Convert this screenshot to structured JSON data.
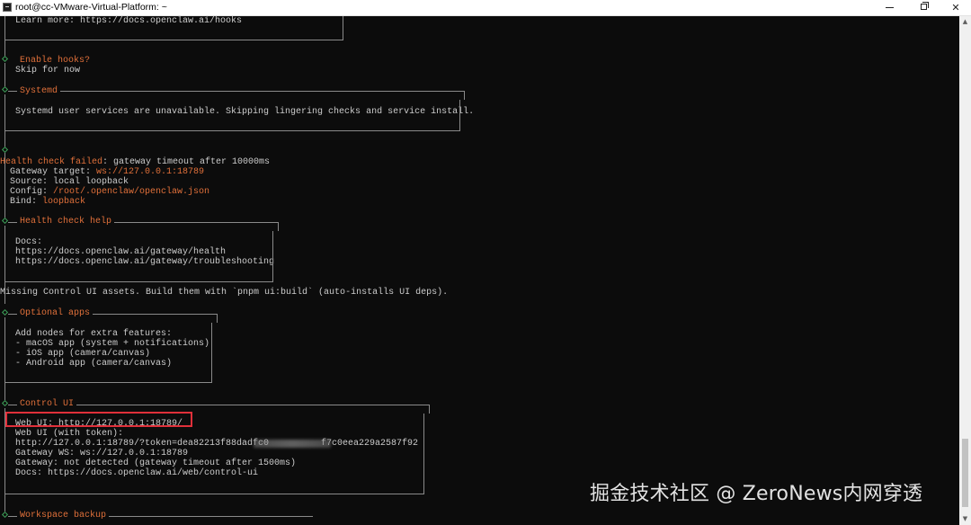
{
  "window": {
    "title": "root@cc-VMware-Virtual-Platform: ~",
    "minimize_label": "minimize",
    "maximize_label": "maximize",
    "close_label": "close"
  },
  "terminal": {
    "hooks_learn_more": "Learn more: https://docs.openclaw.ai/hooks",
    "enable_hooks_q": "Enable hooks?",
    "enable_hooks_a": "Skip for now",
    "systemd_title": "Systemd",
    "systemd_msg": "Systemd user services are unavailable. Skipping lingering checks and service install.",
    "health_failed_label": "Health check failed",
    "health_failed_rest": ": gateway timeout after 10000ms",
    "gateway_target_label": "Gateway target: ",
    "gateway_target_value": "ws://127.0.0.1:18789",
    "source_line": "Source: local loopback",
    "config_label": "Config: ",
    "config_value": "/root/.openclaw/openclaw.json",
    "bind_label": "Bind: ",
    "bind_value": "loopback",
    "health_help_title": "Health check help",
    "docs_label": "Docs:",
    "docs_health": "https://docs.openclaw.ai/gateway/health",
    "docs_troubleshooting": "https://docs.openclaw.ai/gateway/troubleshooting",
    "missing_assets": "Missing Control UI assets. Build them with `pnpm ui:build` (auto-installs UI deps).",
    "optional_apps_title": "Optional apps",
    "optional_intro": "Add nodes for extra features:",
    "optional_items": [
      "- macOS app (system + notifications)",
      "- iOS app (camera/canvas)",
      "- Android app (camera/canvas)"
    ],
    "control_ui_title": "Control UI",
    "web_ui": "Web UI: http://127.0.0.1:18789/",
    "web_ui_token_label": "Web UI (with token):",
    "web_ui_token_start": "http://127.0.0.1:18789/?token=dea82213f88dadfc0",
    "web_ui_token_end": "f7c0eea229a2587f92",
    "gateway_ws": "Gateway WS: ws://127.0.0.1:18789",
    "gateway_status": "Gateway: not detected (gateway timeout after 1500ms)",
    "control_docs": "Docs: https://docs.openclaw.ai/web/control-ui",
    "workspace_backup_title": "Workspace backup"
  },
  "watermark": "掘金技术社区 @ ZeroNews内网穿透",
  "colors": {
    "background": "#0c0c0c",
    "text": "#cccccc",
    "accent": "#e0703a",
    "prompt_diamond": "#3fa25a",
    "highlight_box": "#e0303a"
  },
  "icons": {
    "window": "terminal-app-icon",
    "step": "diamond-step-icon"
  }
}
